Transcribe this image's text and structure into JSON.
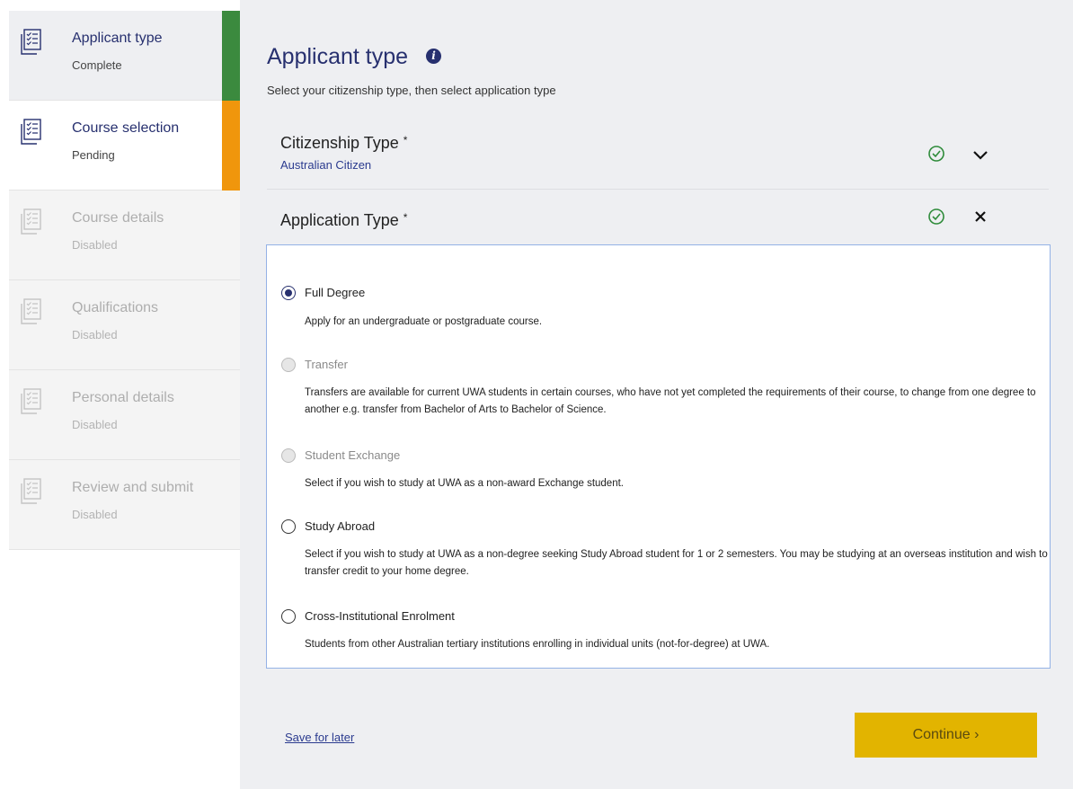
{
  "steps": [
    {
      "label": "Applicant type",
      "status": "Complete",
      "state": "complete"
    },
    {
      "label": "Course selection",
      "status": "Pending",
      "state": "pending"
    },
    {
      "label": "Course details",
      "status": "Disabled",
      "state": "disabled"
    },
    {
      "label": "Qualifications",
      "status": "Disabled",
      "state": "disabled"
    },
    {
      "label": "Personal details",
      "status": "Disabled",
      "state": "disabled"
    },
    {
      "label": "Review and submit",
      "status": "Disabled",
      "state": "disabled"
    }
  ],
  "page": {
    "title": "Applicant type",
    "subtitle": "Select your citizenship type, then select application type"
  },
  "citizenship": {
    "label": "Citizenship Type",
    "required_mark": "*",
    "value": "Australian Citizen"
  },
  "application": {
    "label": "Application Type",
    "required_mark": "*",
    "options": [
      {
        "label": "Full Degree",
        "description": "Apply for an undergraduate or postgraduate course.",
        "state": "checked"
      },
      {
        "label": "Transfer",
        "description": "Transfers are available for current UWA students in certain courses, who have not yet completed the requirements of their course, to change from one degree to another e.g. transfer from Bachelor of Arts to Bachelor of Science.",
        "state": "disabled"
      },
      {
        "label": "Student Exchange",
        "description": "Select if you wish to study at UWA as a non-award Exchange student.",
        "state": "disabled"
      },
      {
        "label": "Study Abroad",
        "description": "Select if you wish to study at UWA as a non-degree seeking Study Abroad student for 1 or 2 semesters. You may be studying at an overseas institution and wish to transfer credit to your home degree.",
        "state": "unchecked"
      },
      {
        "label": "Cross-Institutional Enrolment",
        "description": "Students from other Australian tertiary institutions enrolling in individual units (not-for-degree) at UWA.",
        "state": "unchecked"
      }
    ]
  },
  "footer": {
    "save_label": "Save for later",
    "continue_label": "Continue ›"
  },
  "colors": {
    "complete": "#3b8a3e",
    "pending": "#f0960c",
    "primary": "#27306f",
    "continue": "#e2b400",
    "check": "#2e8b3a"
  },
  "icons": {
    "step": "checklist-icon",
    "info": "info-icon",
    "check": "check-circle-icon",
    "expand": "chevron-down-icon",
    "collapse": "close-icon"
  }
}
